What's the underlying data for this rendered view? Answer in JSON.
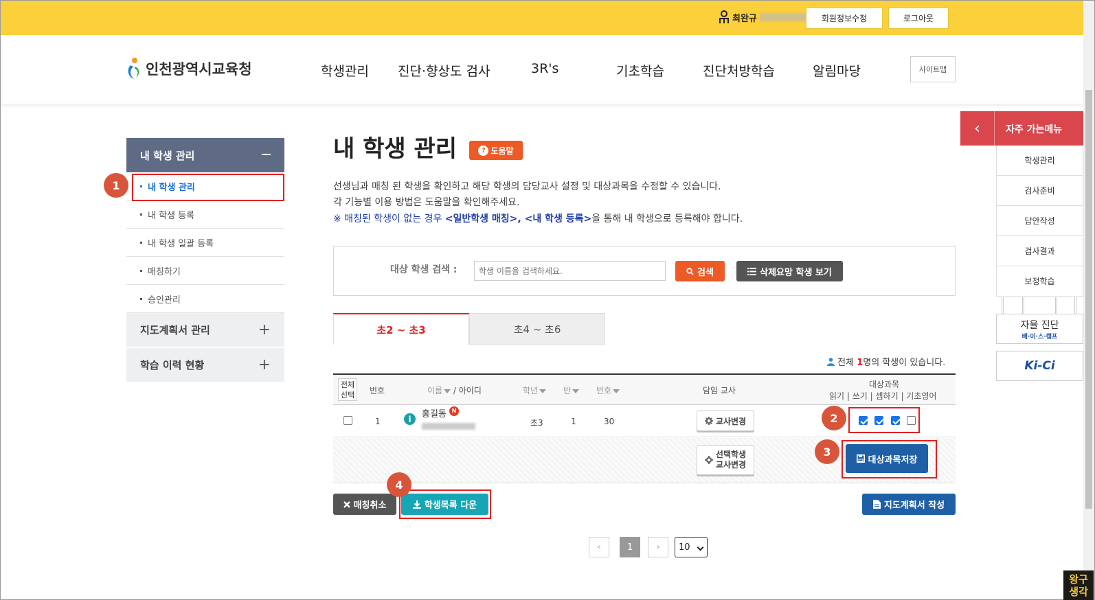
{
  "topbar": {
    "user_name": "최완규",
    "profile_edit": "회원정보수정",
    "logout": "로그아웃"
  },
  "header": {
    "logo_text": "인천광역시교육청",
    "nav": [
      "학생관리",
      "진단·향상도 검사",
      "3R's",
      "기초학습",
      "진단처방학습",
      "알림마당"
    ],
    "sitemap": "사이트맵"
  },
  "sidebar": {
    "head": "내 학생 관리",
    "items": [
      "내 학생 관리",
      "내 학생 등록",
      "내 학생 일괄 등록",
      "매칭하기",
      "승인관리"
    ],
    "groups": [
      "지도계획서 관리",
      "학습 이력 현황"
    ]
  },
  "main": {
    "title": "내 학생 관리",
    "help": "도움말",
    "desc1": "선생님과 매칭 된 학생을 확인하고 해당 학생의 담당교사 설정 및 대상과목을 수정할 수 있습니다.",
    "desc2": "각 기능별 이용 방법은 도움말을 확인해주세요.",
    "note_prefix": "※ 매칭된 학생이 없는 경우 ",
    "note_links": "<일반학생 매칭>, <내 학생 등록>",
    "note_suffix": "을 통해 내 학생으로 등록해야 합니다."
  },
  "search": {
    "label": "대상 학생 검색 :",
    "placeholder": "학생 이름을 검색하세요.",
    "search_btn": "검색",
    "delete_view_btn": "삭제요망 학생 보기"
  },
  "tabs": [
    "초2 ~ 초3",
    "초4 ~ 초6"
  ],
  "total": {
    "prefix": "전체 ",
    "count": "1",
    "suffix": "명의 학생이 있습니다."
  },
  "table": {
    "headers": {
      "select_all_1": "전체",
      "select_all_2": "선택",
      "no": "번호",
      "name": "이름",
      "id": " / 아이디",
      "grade": "학년",
      "class": "반",
      "number": "번호",
      "teacher": "담임 교사",
      "subjects": "대상과목",
      "subject_list": "읽기 | 쓰기 | 셈하기 | 기초영어"
    },
    "rows": [
      {
        "no": "1",
        "name": "홍길동",
        "new_badge": "N",
        "grade": "초3",
        "class": "1",
        "number": "30",
        "change_teacher": "교사변경",
        "subjects": [
          true,
          true,
          true,
          false
        ]
      }
    ],
    "selected_teacher_change_1": "선택학생",
    "selected_teacher_change_2": "교사변경",
    "save_subjects": "대상과목저장"
  },
  "actions": {
    "unmatch": "매칭취소",
    "download": "학생목록 다운",
    "write_plan": "지도계획서 작성"
  },
  "pagination": {
    "current": "1",
    "per_page": "10"
  },
  "quick_menu": {
    "title": "자주 가는메뉴",
    "items": [
      "학생관리",
      "검사준비",
      "답안작성",
      "검사결과",
      "보정학습"
    ],
    "link1_title": "자율 진단",
    "link1_sub": "배·이·스·캠프",
    "link2_title": "Ki-Ci"
  },
  "annotations": [
    "1",
    "2",
    "3",
    "4"
  ],
  "watermark": "왕구생각",
  "colors": {
    "topbar": "#fbd03a",
    "sidebar_head": "#5f6b85",
    "accent_red": "#e02020",
    "search_btn": "#ed5a26",
    "download_btn": "#17a6b5",
    "save_btn": "#1f5fa6",
    "quick_head": "#d9474d"
  }
}
